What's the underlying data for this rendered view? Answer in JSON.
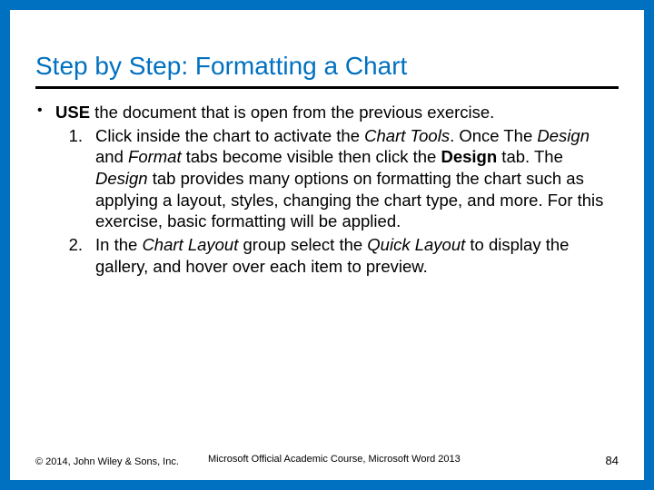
{
  "title": "Step by Step: Formatting a Chart",
  "bullet": {
    "use_label": "USE",
    "use_rest": " the document that is open from the previous exercise."
  },
  "steps": {
    "s1": {
      "num": "1.",
      "a": "Click inside the chart to activate the ",
      "b": "Chart Tools",
      "c": ". Once The ",
      "d": "Design",
      "e": " and ",
      "f": "Format",
      "g": " tabs become visible then click the ",
      "h": "Design",
      "i": " tab. The ",
      "j": "Design",
      "k": " tab provides many options on formatting the chart such as applying a layout, styles, changing the chart type, and more. For this exercise, basic formatting will be applied."
    },
    "s2": {
      "num": "2.",
      "a": "In the ",
      "b": "Chart Layout",
      "c": " group select the ",
      "d": "Quick Layout",
      "e": " to display the gallery, and hover over each item to preview."
    }
  },
  "footer": {
    "left": "© 2014, John Wiley & Sons, Inc.",
    "center": "Microsoft Official Academic Course, Microsoft Word 2013",
    "right": "84"
  }
}
